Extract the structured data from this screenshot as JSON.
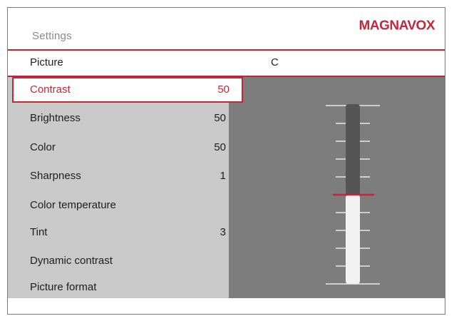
{
  "header": {
    "title": "Settings",
    "brand": "MAGNAVOX"
  },
  "breadcrumb": {
    "label": "Picture",
    "value": "C"
  },
  "menu": {
    "items": [
      {
        "label": "Contrast",
        "value": "50",
        "selected": true
      },
      {
        "label": "Brightness",
        "value": "50",
        "selected": false
      },
      {
        "label": "Color",
        "value": "50",
        "selected": false
      },
      {
        "label": "Sharpness",
        "value": "1",
        "selected": false
      },
      {
        "label": "Color temperature",
        "value": "",
        "selected": false
      },
      {
        "label": "Tint",
        "value": "3",
        "selected": false
      },
      {
        "label": "Dynamic contrast",
        "value": "",
        "selected": false
      },
      {
        "label": "Picture format",
        "value": "",
        "selected": false
      }
    ]
  },
  "slider": {
    "value": 50,
    "min": 0,
    "max": 100
  },
  "colors": {
    "accent": "#c2273a",
    "menu_bg": "#c9c9c9",
    "slider_bg": "#7d7d7d",
    "track_upper": "#555555",
    "track_lower": "#f2f2f2"
  }
}
